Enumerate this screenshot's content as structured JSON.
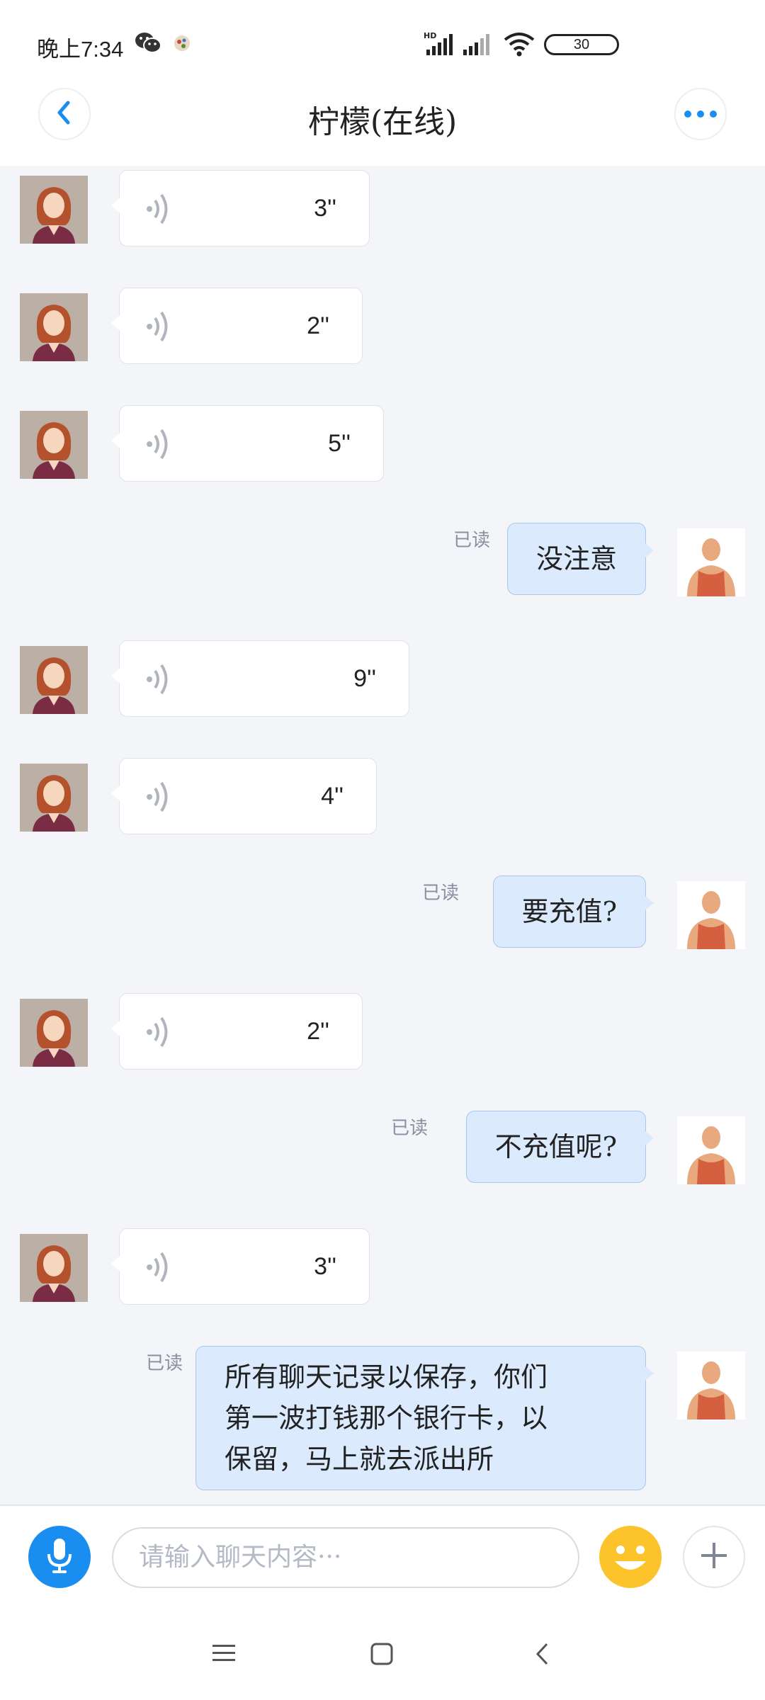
{
  "status_bar": {
    "time": "晚上7:34",
    "battery": "30",
    "icons": [
      "wechat-icon",
      "app-notification-icon",
      "hd-signal-icon",
      "signal-icon",
      "wifi-icon",
      "battery-icon"
    ]
  },
  "header": {
    "title": "柠檬(在线)",
    "back_icon": "chevron-left-icon",
    "more_icon": "more-dots-icon"
  },
  "messages": [
    {
      "type": "voice",
      "direction": "in",
      "duration": "3''"
    },
    {
      "type": "voice",
      "direction": "in",
      "duration": "2''"
    },
    {
      "type": "voice",
      "direction": "in",
      "duration": "5''"
    },
    {
      "type": "text",
      "direction": "out",
      "text": "没注意",
      "read": "已读"
    },
    {
      "type": "voice",
      "direction": "in",
      "duration": "9''"
    },
    {
      "type": "voice",
      "direction": "in",
      "duration": "4''"
    },
    {
      "type": "text",
      "direction": "out",
      "text": "要充值?",
      "read": "已读"
    },
    {
      "type": "voice",
      "direction": "in",
      "duration": "2''"
    },
    {
      "type": "text",
      "direction": "out",
      "text": "不充值呢?",
      "read": "已读"
    },
    {
      "type": "voice",
      "direction": "in",
      "duration": "3''"
    },
    {
      "type": "text",
      "direction": "out",
      "text": "所有聊天记录以保存，你们\n第一波打钱那个银行卡，以\n保留，马上就去派出所",
      "read": "已读"
    }
  ],
  "input_bar": {
    "placeholder": "请输入聊天内容···",
    "mic_icon": "microphone-icon",
    "emoji_icon": "smiley-icon",
    "plus_icon": "plus-icon"
  },
  "colors": {
    "accent": "#1a8ef0",
    "outgoing_bubble": "#dbeafc",
    "incoming_bubble": "#ffffff",
    "background": "#f4f5f9"
  }
}
